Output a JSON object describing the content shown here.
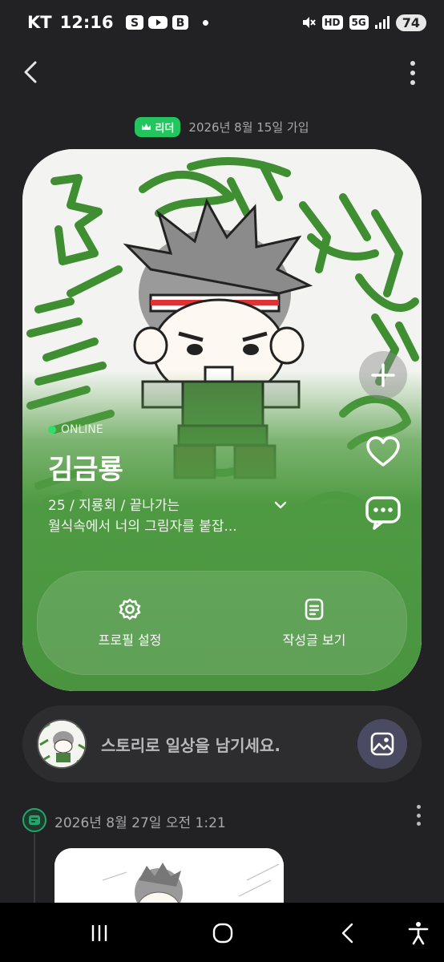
{
  "status_bar": {
    "carrier": "KT",
    "time": "12:16",
    "icons": [
      "samsung-s-icon",
      "youtube-icon",
      "blog-b-icon"
    ],
    "hd_label": "HD",
    "net_label": "5G",
    "battery": "74"
  },
  "header": {
    "back_icon": "chevron-left-icon",
    "more_icon": "more-vertical-icon"
  },
  "profile": {
    "badge_label": "리더",
    "join_text": "2026년 8월 15일 가입",
    "status_text": "ONLINE",
    "name": "김금룡",
    "bio_line1": "25 / 지룡회 / 끝나가는",
    "bio_line2": "월식속에서 너의 그림자를 붙잡...",
    "actions": {
      "settings_label": "프로필 설정",
      "posts_label": "작성글 보기"
    },
    "side_buttons": [
      "plus-icon",
      "heart-icon",
      "chat-bubble-icon"
    ]
  },
  "story": {
    "prompt": "스토리로 일상을 남기세요."
  },
  "timeline": {
    "date": "2026년 8월 27일 오전 1:21"
  },
  "colors": {
    "background": "#222224",
    "accent_green": "#22c55e",
    "card_green": "#4e9a42",
    "story_bar": "#2d2d2f",
    "image_button": "#4a4a63"
  }
}
